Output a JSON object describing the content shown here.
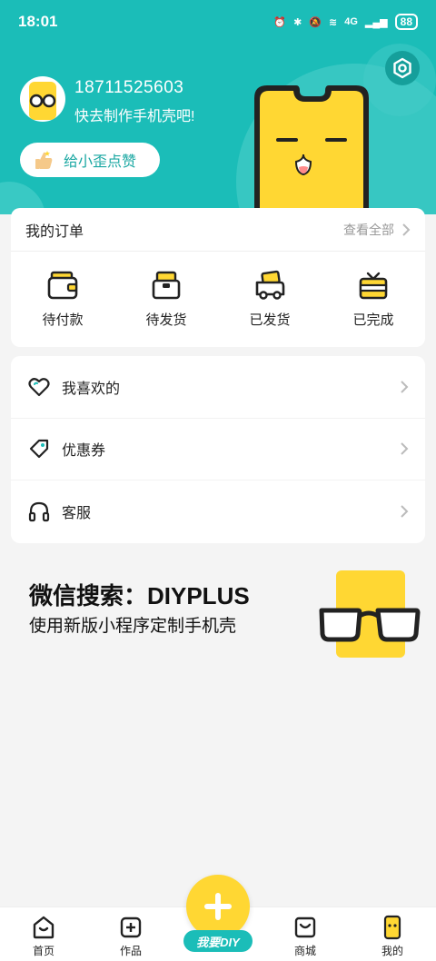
{
  "status_bar": {
    "time": "18:01",
    "network": "4G",
    "battery": "88"
  },
  "profile": {
    "phone": "18711525603",
    "slogan": "快去制作手机壳吧!",
    "like_button": "给小歪点赞"
  },
  "orders": {
    "title": "我的订单",
    "view_all": "查看全部",
    "items": [
      {
        "label": "待付款",
        "icon": "wallet-icon"
      },
      {
        "label": "待发货",
        "icon": "package-icon"
      },
      {
        "label": "已发货",
        "icon": "truck-icon"
      },
      {
        "label": "已完成",
        "icon": "gift-icon"
      }
    ]
  },
  "menu": [
    {
      "label": "我喜欢的",
      "icon": "heart-icon"
    },
    {
      "label": "优惠券",
      "icon": "coupon-icon"
    },
    {
      "label": "客服",
      "icon": "headset-icon"
    }
  ],
  "promo": {
    "title": "微信搜索：DIYPLUS",
    "subtitle": "使用新版小程序定制手机壳"
  },
  "tabbar": {
    "home": "首页",
    "works": "作品",
    "diy": "我要DIY",
    "shop": "商城",
    "mine": "我的"
  },
  "colors": {
    "brand": "#1bbdb8",
    "accent": "#ffd733",
    "text": "#222222"
  }
}
